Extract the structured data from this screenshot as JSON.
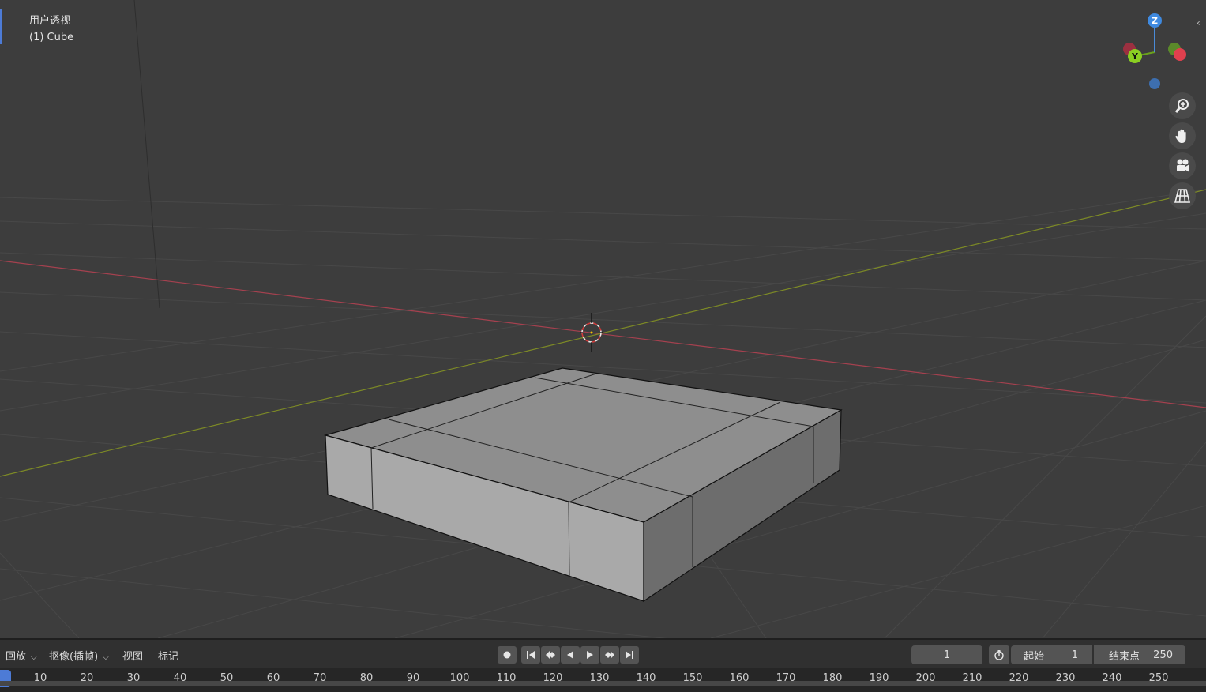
{
  "viewport": {
    "view_name": "用户透视",
    "object_label": "(1) Cube",
    "gizmo_axes": [
      "Z",
      "Y"
    ],
    "nav_icons": [
      "zoom-icon",
      "pan-hand-icon",
      "camera-icon",
      "perspective-grid-icon"
    ]
  },
  "timeline": {
    "menus": {
      "playback": "回放",
      "keying": "抠像(插帧)",
      "view": "视图",
      "marker": "标记"
    },
    "current_frame": "1",
    "start_label": "起始",
    "start_value": "1",
    "end_label": "结束点",
    "end_value": "250",
    "ruler_ticks": [
      "10",
      "20",
      "30",
      "40",
      "50",
      "60",
      "70",
      "80",
      "90",
      "100",
      "110",
      "120",
      "130",
      "140",
      "150",
      "160",
      "170",
      "180",
      "190",
      "200",
      "210",
      "220",
      "230",
      "240",
      "250"
    ]
  },
  "colors": {
    "background": "#3d3d3d",
    "x_axis": "#c04455",
    "y_axis": "#8b9a2a",
    "accent": "#4d7bd6"
  }
}
